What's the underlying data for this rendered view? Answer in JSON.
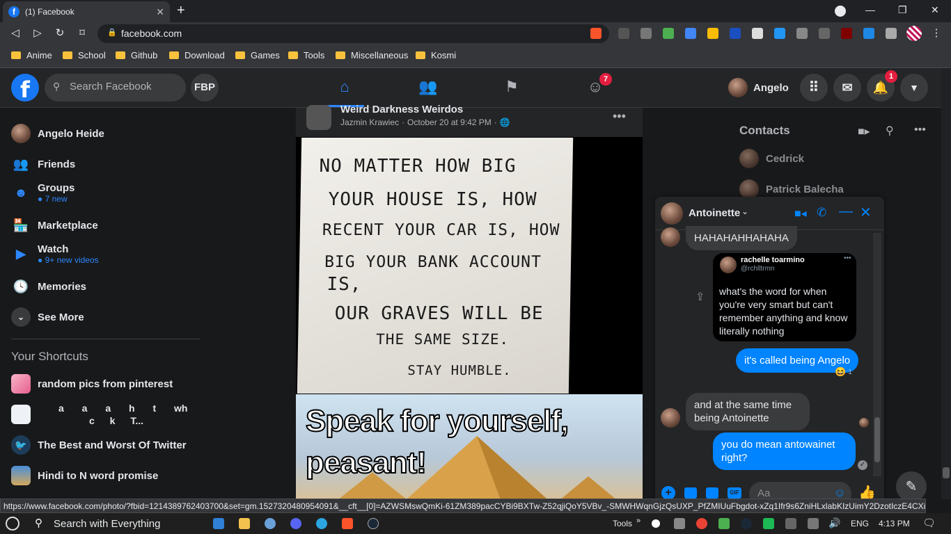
{
  "browser": {
    "tab_title": "(1) Facebook",
    "tab_favicon": "f",
    "url": "facebook.com",
    "bookmarks": [
      "Anime",
      "School",
      "Github",
      "Download",
      "Games",
      "Tools",
      "Miscellaneous",
      "Kosmi"
    ],
    "status_url": "https://www.facebook.com/photo/?fbid=1214389762403700&set=gm.1527320480954091&__cft__[0]=AZWSMswQmKi-61ZM389pacCYBi9BXTw-Z52qjiQoY5VBv_-SMWHWqnGjzQsUXP_PfZMIUuFbgdot-xZq1Ifr9s6ZniHLxlabKIzUimY2DzotIczE4CXiQ5..."
  },
  "header": {
    "search_placeholder": "Search Facebook",
    "shortcut_label": "FBP",
    "groups_badge": "7",
    "profile_name": "Angelo",
    "notif_badge": "1"
  },
  "sidebar": {
    "profile": "Angelo Heide",
    "items": [
      {
        "label": "Friends",
        "sub": ""
      },
      {
        "label": "Groups",
        "sub": "7 new"
      },
      {
        "label": "Marketplace",
        "sub": ""
      },
      {
        "label": "Watch",
        "sub": "9+ new videos"
      },
      {
        "label": "Memories",
        "sub": ""
      },
      {
        "label": "See More",
        "sub": ""
      }
    ],
    "shortcuts_title": "Your Shortcuts",
    "shortcuts": [
      "random pics from pinterest",
      "a a a h t wh",
      "c k T...",
      "The Best and Worst Of Twitter",
      "Hindi to N word promise"
    ]
  },
  "post": {
    "group": "Weird Darkness Weirdos",
    "author": "Jazmin Krawiec",
    "time": "October 20 at 9:42 PM",
    "meme_lines": [
      "NO MATTER HOW BIG",
      "YOUR HOUSE IS, HOW",
      "RECENT YOUR CAR IS, HOW",
      "BIG YOUR BANK ACCOUNT",
      "IS,",
      "OUR GRAVES WILL BE",
      "THE SAME SIZE.",
      "STAY HUMBLE."
    ],
    "caption_1": "Speak for yourself,",
    "caption_2": "peasant!"
  },
  "contacts": {
    "title": "Contacts",
    "list": [
      "Cedrick",
      "Patrick Balecha"
    ]
  },
  "chat": {
    "name": "Antoinette",
    "messages": {
      "m1": "HAHAHAHHAHAHA",
      "tweet_name": "rachelle toarmino",
      "tweet_handle": "@rchlltrmn",
      "tweet_text": "what's the word for when you're very smart but can't remember anything and know literally nothing",
      "m2": "it's called being Angelo",
      "m2_reaction_count": "1",
      "m3": "and at the same time being Antoinette",
      "m4": "you do mean antowainet right?"
    },
    "input_placeholder": "Aa"
  },
  "taskbar": {
    "search": "Search with Everything",
    "tools": "Tools",
    "lang": "ENG",
    "time": "4:13 PM"
  }
}
